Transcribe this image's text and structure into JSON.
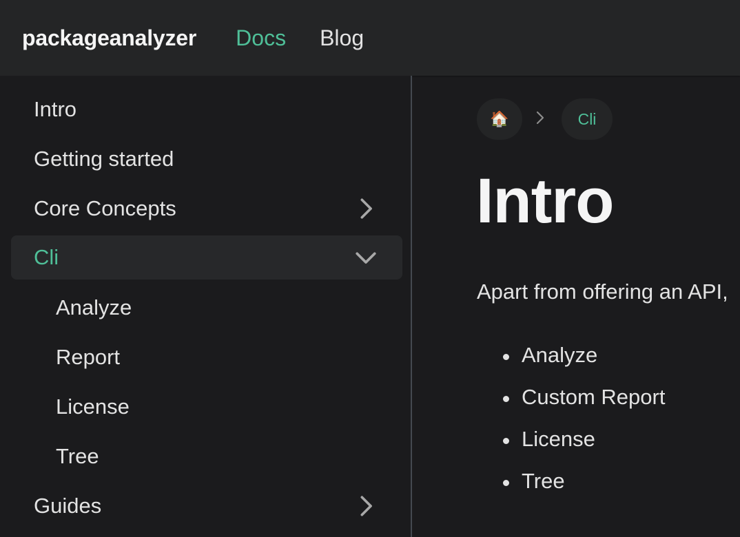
{
  "navbar": {
    "brand": "packageanalyzer",
    "links": [
      {
        "label": "Docs",
        "active": true
      },
      {
        "label": "Blog",
        "active": false
      }
    ]
  },
  "sidebar": {
    "items": [
      {
        "label": "Intro"
      },
      {
        "label": "Getting started"
      },
      {
        "label": "Core Concepts",
        "icon": "chevron-right-icon"
      },
      {
        "label": "Cli",
        "icon": "chevron-down-icon",
        "active": true,
        "expanded": true
      },
      {
        "label": "Analyze",
        "level": 2
      },
      {
        "label": "Report",
        "level": 2
      },
      {
        "label": "License",
        "level": 2
      },
      {
        "label": "Tree",
        "level": 2
      },
      {
        "label": "Guides",
        "icon": "chevron-right-icon"
      }
    ]
  },
  "breadcrumb": {
    "home_icon": "🏠",
    "separator_icon": "chevron-right-icon",
    "current": "Cli"
  },
  "main": {
    "title": "Intro",
    "text": "Apart from offering an API,",
    "bullets": [
      "Analyze",
      "Custom Report",
      "License",
      "Tree"
    ]
  },
  "colors": {
    "accent": "#4fbf98",
    "navbar_bg": "#242526",
    "page_bg": "#1b1b1d",
    "active_item_bg": "#27282a"
  }
}
